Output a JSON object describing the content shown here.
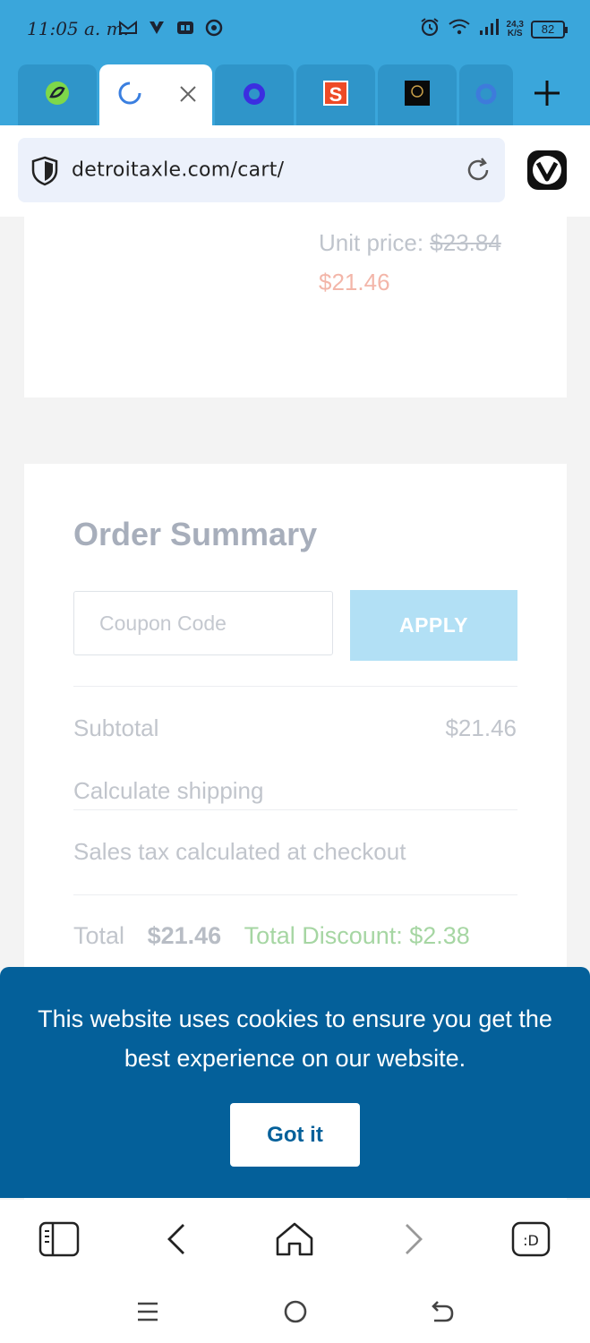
{
  "status_bar": {
    "time": "11:05 a. m.",
    "net_speed_value": "24,3",
    "net_speed_unit": "K/S",
    "battery": "82"
  },
  "tabs": [
    {
      "name": "green-leaf-tab",
      "active": false
    },
    {
      "name": "loading-tab",
      "active": true
    },
    {
      "name": "purple-circle-tab",
      "active": false
    },
    {
      "name": "s-logo-tab",
      "active": false
    },
    {
      "name": "dark-logo-tab",
      "active": false
    },
    {
      "name": "partial-tab",
      "active": false
    }
  ],
  "address_bar": {
    "url": "detroitaxle.com/cart/"
  },
  "cart_item": {
    "unit_price_label": "Unit price:",
    "original_price": "$23.84",
    "sale_price": "$21.46"
  },
  "order_summary": {
    "title": "Order Summary",
    "coupon_placeholder": "Coupon Code",
    "apply_label": "APPLY",
    "subtotal_label": "Subtotal",
    "subtotal_value": "$21.46",
    "shipping_label": "Calculate shipping",
    "tax_label": "Sales tax calculated at checkout",
    "total_label": "Total",
    "total_value": "$21.46",
    "total_discount": "Total Discount: $2.38"
  },
  "cookie_banner": {
    "message": "This website uses cookies to ensure you get the best experience on our website.",
    "button_label": "Got it"
  },
  "colors": {
    "status_bar": "#3aa6db",
    "cookie_banner": "#04609a",
    "apply_button": "#b2e0f5",
    "discount_text": "#a6d6a3",
    "sale_price": "#f3b6a9"
  }
}
